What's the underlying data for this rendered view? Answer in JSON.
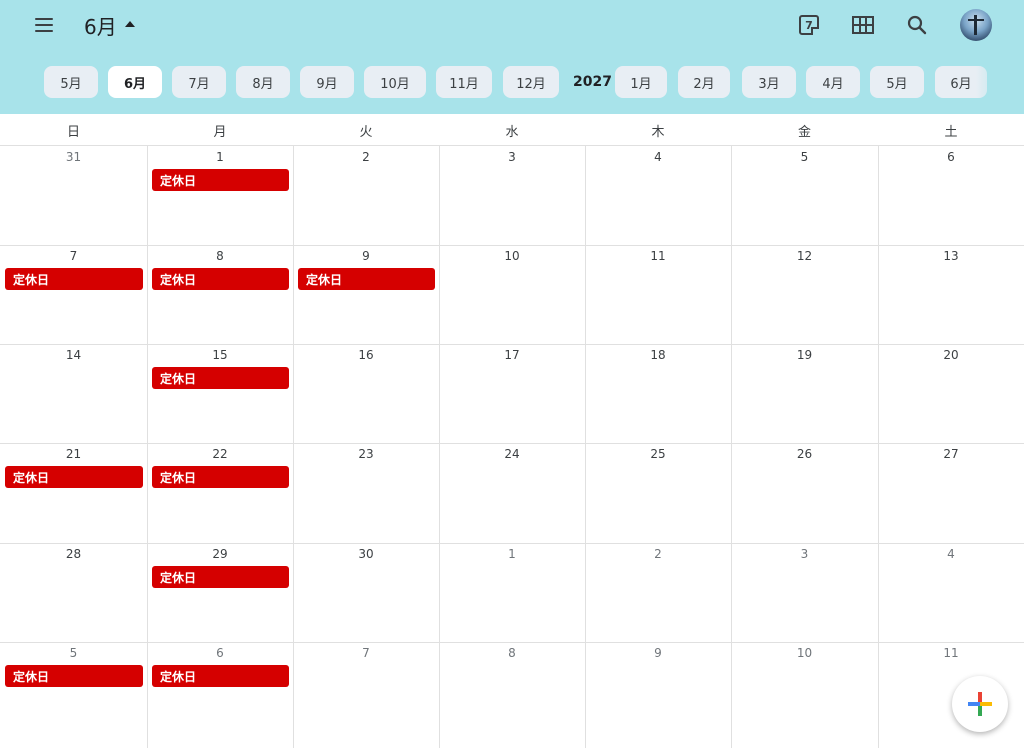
{
  "header": {
    "month_title": "6月",
    "today_day": "7"
  },
  "month_chips": [
    {
      "label": "5月",
      "selected": false
    },
    {
      "label": "6月",
      "selected": true
    },
    {
      "label": "7月",
      "selected": false
    },
    {
      "label": "8月",
      "selected": false
    },
    {
      "label": "9月",
      "selected": false
    },
    {
      "label": "10月",
      "selected": false
    },
    {
      "label": "11月",
      "selected": false
    },
    {
      "label": "12月",
      "selected": false
    },
    {
      "label": "1月",
      "selected": false
    },
    {
      "label": "2月",
      "selected": false
    },
    {
      "label": "3月",
      "selected": false
    },
    {
      "label": "4月",
      "selected": false
    },
    {
      "label": "5月",
      "selected": false
    },
    {
      "label": "6月",
      "selected": false
    }
  ],
  "year_label": "2027",
  "weekdays": [
    "日",
    "月",
    "火",
    "水",
    "木",
    "金",
    "土"
  ],
  "weeks": [
    {
      "days": [
        {
          "num": "31",
          "other": true,
          "event": ""
        },
        {
          "num": "1",
          "other": false,
          "event": "定休日"
        },
        {
          "num": "2",
          "other": false,
          "event": ""
        },
        {
          "num": "3",
          "other": false,
          "event": ""
        },
        {
          "num": "4",
          "other": false,
          "event": ""
        },
        {
          "num": "5",
          "other": false,
          "event": ""
        },
        {
          "num": "6",
          "other": false,
          "event": ""
        }
      ]
    },
    {
      "days": [
        {
          "num": "7",
          "other": false,
          "event": "定休日"
        },
        {
          "num": "8",
          "other": false,
          "event": "定休日"
        },
        {
          "num": "9",
          "other": false,
          "event": "定休日"
        },
        {
          "num": "10",
          "other": false,
          "event": ""
        },
        {
          "num": "11",
          "other": false,
          "event": ""
        },
        {
          "num": "12",
          "other": false,
          "event": ""
        },
        {
          "num": "13",
          "other": false,
          "event": ""
        }
      ]
    },
    {
      "days": [
        {
          "num": "14",
          "other": false,
          "event": ""
        },
        {
          "num": "15",
          "other": false,
          "event": "定休日"
        },
        {
          "num": "16",
          "other": false,
          "event": ""
        },
        {
          "num": "17",
          "other": false,
          "event": ""
        },
        {
          "num": "18",
          "other": false,
          "event": ""
        },
        {
          "num": "19",
          "other": false,
          "event": ""
        },
        {
          "num": "20",
          "other": false,
          "event": ""
        }
      ]
    },
    {
      "days": [
        {
          "num": "21",
          "other": false,
          "event": "定休日"
        },
        {
          "num": "22",
          "other": false,
          "event": "定休日"
        },
        {
          "num": "23",
          "other": false,
          "event": ""
        },
        {
          "num": "24",
          "other": false,
          "event": ""
        },
        {
          "num": "25",
          "other": false,
          "event": ""
        },
        {
          "num": "26",
          "other": false,
          "event": ""
        },
        {
          "num": "27",
          "other": false,
          "event": ""
        }
      ]
    },
    {
      "days": [
        {
          "num": "28",
          "other": false,
          "event": ""
        },
        {
          "num": "29",
          "other": false,
          "event": "定休日"
        },
        {
          "num": "30",
          "other": false,
          "event": ""
        },
        {
          "num": "1",
          "other": true,
          "event": ""
        },
        {
          "num": "2",
          "other": true,
          "event": ""
        },
        {
          "num": "3",
          "other": true,
          "event": ""
        },
        {
          "num": "4",
          "other": true,
          "event": ""
        }
      ]
    },
    {
      "days": [
        {
          "num": "5",
          "other": true,
          "event": "定休日"
        },
        {
          "num": "6",
          "other": true,
          "event": "定休日"
        },
        {
          "num": "7",
          "other": true,
          "event": ""
        },
        {
          "num": "8",
          "other": true,
          "event": ""
        },
        {
          "num": "9",
          "other": true,
          "event": ""
        },
        {
          "num": "10",
          "other": true,
          "event": ""
        },
        {
          "num": "11",
          "other": true,
          "event": ""
        }
      ]
    }
  ],
  "colors": {
    "header_bg": "#a8e3ea",
    "event_bg": "#d50000",
    "chip_bg": "#e8eef4",
    "chip_selected_bg": "#ffffff"
  },
  "icons": {
    "menu": "hamburger-menu-icon",
    "today": "calendar-today-icon",
    "view": "grid-view-icon",
    "search": "search-icon",
    "create": "plus-icon"
  }
}
